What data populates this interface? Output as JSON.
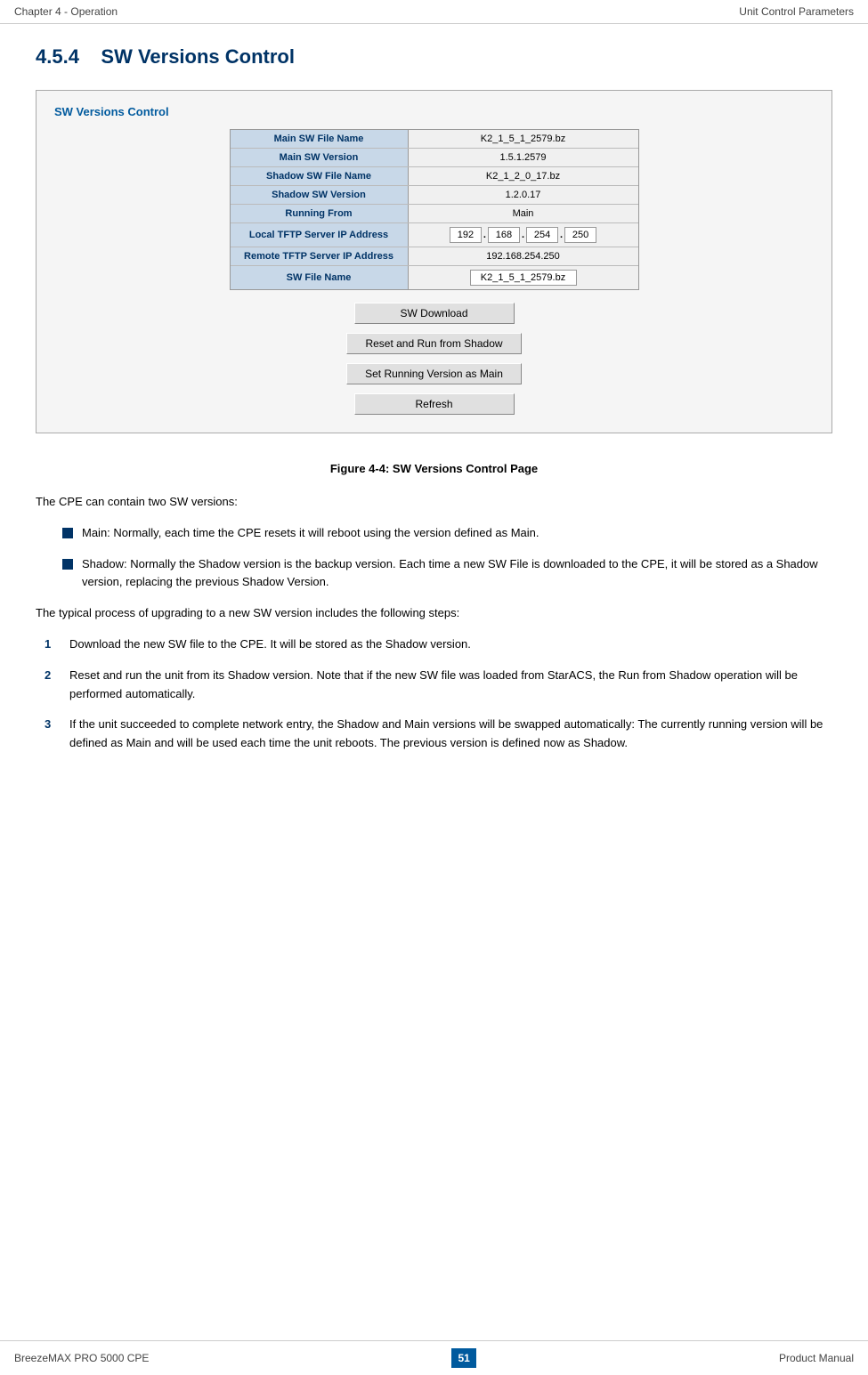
{
  "header": {
    "left": "Chapter 4 - Operation",
    "right": "Unit Control Parameters"
  },
  "section": {
    "number": "4.5.4",
    "title": "SW Versions Control"
  },
  "figure": {
    "panel_title": "SW Versions Control",
    "table": {
      "rows": [
        {
          "label": "Main SW File Name",
          "value": "K2_1_5_1_2579.bz",
          "type": "text"
        },
        {
          "label": "Main SW Version",
          "value": "1.5.1.2579",
          "type": "text"
        },
        {
          "label": "Shadow SW File Name",
          "value": "K2_1_2_0_17.bz",
          "type": "text"
        },
        {
          "label": "Shadow SW Version",
          "value": "1.2.0.17",
          "type": "text"
        },
        {
          "label": "Running From",
          "value": "Main",
          "type": "text"
        },
        {
          "label": "Local TFTP Server IP Address",
          "value": "",
          "type": "ip",
          "ip": [
            "192",
            "168",
            "254",
            "250"
          ]
        },
        {
          "label": "Remote TFTP Server IP Address",
          "value": "192.168.254.250",
          "type": "text"
        },
        {
          "label": "SW File Name",
          "value": "K2_1_5_1_2579.bz",
          "type": "input"
        }
      ]
    },
    "buttons": [
      {
        "id": "sw-download",
        "label": "SW Download"
      },
      {
        "id": "reset-run-shadow",
        "label": "Reset and Run from Shadow"
      },
      {
        "id": "set-running-main",
        "label": "Set Running Version as Main"
      },
      {
        "id": "refresh",
        "label": "Refresh"
      }
    ],
    "caption": "Figure 4-4: SW Versions Control Page"
  },
  "body": {
    "intro": "The CPE can contain two SW versions:",
    "bullets": [
      {
        "text": "Main: Normally, each time the CPE resets it will reboot using the version defined as Main."
      },
      {
        "text": "Shadow: Normally the Shadow version is the backup version. Each time a new SW File is downloaded to the CPE, it will be stored as a Shadow version, replacing the previous Shadow Version."
      }
    ],
    "typical_process_intro": "The typical process of upgrading to a new SW version includes the following steps:",
    "steps": [
      {
        "num": "1",
        "text": "Download the new SW file to the CPE. It will be stored as the Shadow version."
      },
      {
        "num": "2",
        "text": "Reset and run the unit from its Shadow version. Note that if the new SW file was loaded from StarACS, the Run from Shadow operation will be performed automatically."
      },
      {
        "num": "3",
        "text": "If the unit succeeded to complete network entry, the Shadow and Main versions will be swapped automatically: The currently running version will be defined as Main and will be used each time the unit reboots. The previous version is defined now as Shadow."
      }
    ]
  },
  "footer": {
    "left": "BreezeMAX PRO 5000 CPE",
    "page": "51",
    "right": "Product Manual"
  }
}
